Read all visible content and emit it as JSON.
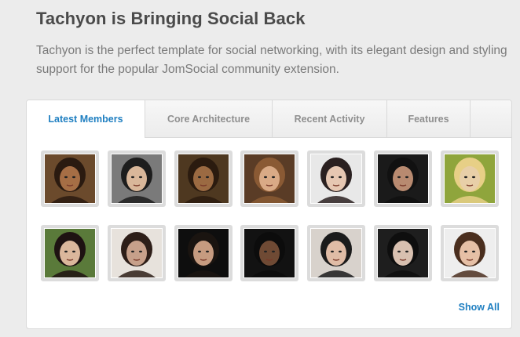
{
  "header": {
    "title": "Tachyon is Bringing Social Back",
    "intro": "Tachyon is the perfect template for social networking, with its elegant design and styling support for the popular JomSocial community extension."
  },
  "tabs": [
    {
      "label": "Latest Members",
      "active": true
    },
    {
      "label": "Core Architecture",
      "active": false
    },
    {
      "label": "Recent Activity",
      "active": false
    },
    {
      "label": "Features",
      "active": false
    }
  ],
  "members": [
    {
      "bg": "#6b4a2c",
      "skin": "#a66e45",
      "hair": "#2a1a10"
    },
    {
      "bg": "#7a7a7a",
      "skin": "#d9b79a",
      "hair": "#1d1d1d"
    },
    {
      "bg": "#4e3820",
      "skin": "#9b6a42",
      "hair": "#2b1b0f"
    },
    {
      "bg": "#5a3c26",
      "skin": "#d9aa86",
      "hair": "#8a5a34"
    },
    {
      "bg": "#e8e8e8",
      "skin": "#e6c7b2",
      "hair": "#2a2020"
    },
    {
      "bg": "#1a1a1a",
      "skin": "#b88a70",
      "hair": "#111111"
    },
    {
      "bg": "#8fa53c",
      "skin": "#e8cfa8",
      "hair": "#e7cf86"
    },
    {
      "bg": "#5a7a3a",
      "skin": "#dbb79c",
      "hair": "#1e1212"
    },
    {
      "bg": "#e7e2dc",
      "skin": "#c7a08a",
      "hair": "#2d1e18"
    },
    {
      "bg": "#0e0e0e",
      "skin": "#c69b80",
      "hair": "#1a1410"
    },
    {
      "bg": "#121212",
      "skin": "#6f4a34",
      "hair": "#0c0c0c"
    },
    {
      "bg": "#d8d2cc",
      "skin": "#e0bca6",
      "hair": "#1b1b1b"
    },
    {
      "bg": "#1e1e1e",
      "skin": "#d8c0b0",
      "hair": "#0e0e0e"
    },
    {
      "bg": "#eeeeee",
      "skin": "#e6c0a6",
      "hair": "#4a2e1e"
    }
  ],
  "show_all_label": "Show All",
  "colors": {
    "accent": "#1f7fc1",
    "heading": "#4a4a4a",
    "body": "#7a7a7a"
  }
}
